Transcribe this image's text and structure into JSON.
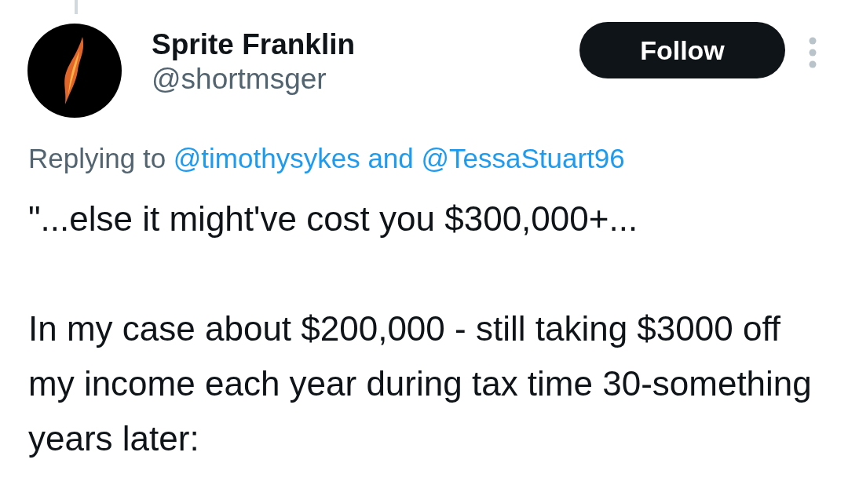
{
  "author": {
    "name": "Sprite Franklin",
    "handle": "@shortmsger"
  },
  "follow_button": {
    "label": "Follow"
  },
  "replying_to": {
    "prefix": "Replying to",
    "mentions": [
      "@timothysykes",
      "@TessaStuart96"
    ],
    "joiner": "and"
  },
  "paragraphs": [
    "\"...else it might've cost you $300,000+...",
    "In my case about $200,000 - still taking $3000 off my income each year during tax time 30-something years later:"
  ]
}
